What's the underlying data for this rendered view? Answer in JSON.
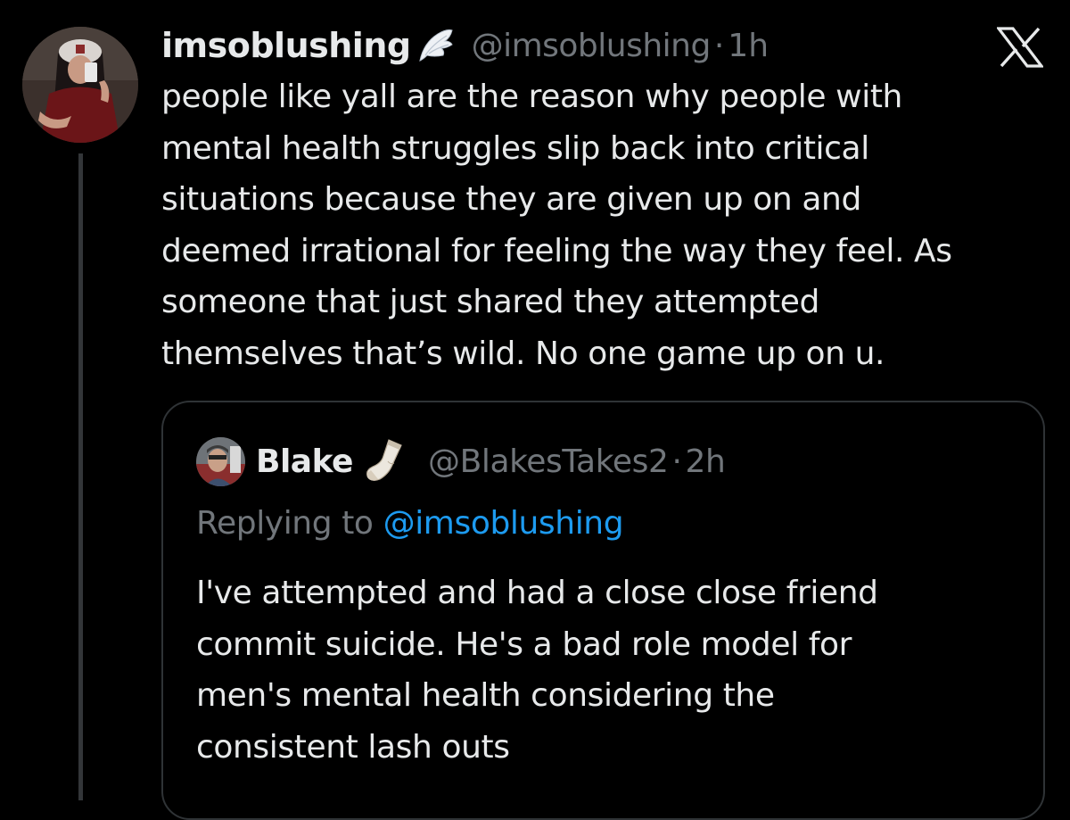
{
  "colors": {
    "background": "#000000",
    "primary_text": "#e7e9ea",
    "secondary_text": "#71767b",
    "link": "#1d9bf0",
    "border": "#2f3336"
  },
  "tweet": {
    "author": {
      "display_name": "imsoblushing",
      "badge_icon": "angel-wing-icon",
      "handle": "@imsoblushing",
      "separator": "·",
      "time": "1h"
    },
    "app_icon": "x-logo-icon",
    "text_lines": [
      "people like yall are the reason why people with",
      "mental health struggles slip back into critical",
      "situations because they are given up on and",
      "deemed irrational for feeling the way they feel. As",
      "someone that just shared they attempted",
      "themselves that’s wild. No one game up on u."
    ]
  },
  "quote": {
    "author": {
      "display_name": "Blake",
      "badge_icon": "sock-icon",
      "handle": "@BlakesTakes2",
      "separator": "·",
      "time": "2h"
    },
    "replying_prefix": "Replying to",
    "replying_mention": "@imsoblushing",
    "text_lines": [
      "I've attempted and had a close close friend",
      "commit suicide. He's a bad role model for",
      "men's mental health considering the",
      "consistent lash outs"
    ]
  }
}
